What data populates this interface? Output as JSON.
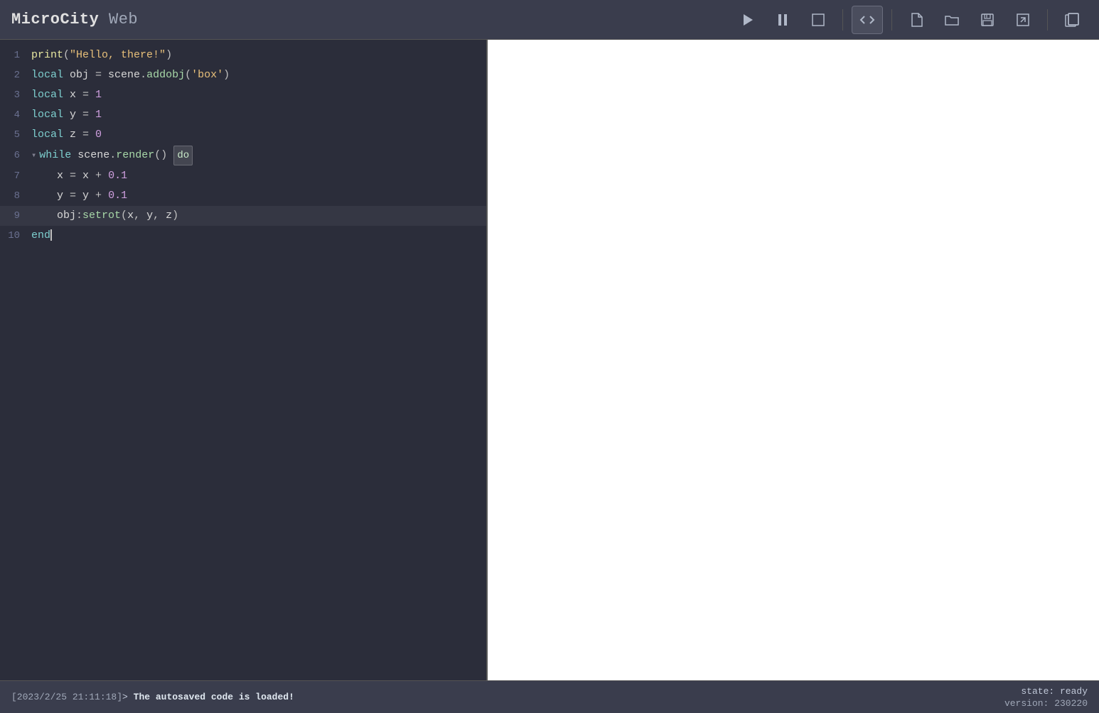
{
  "app": {
    "title_micro": "Micro",
    "title_city": "City",
    "title_web": " Web"
  },
  "toolbar": {
    "run_label": "▶",
    "pause_label": "⏸",
    "stop_label": "☐",
    "code_view_label": "<>",
    "new_file_label": "🗋",
    "open_file_label": "🗁",
    "save_file_label": "💾",
    "export_label": "⬡",
    "multi_file_label": "❑"
  },
  "editor": {
    "lines": [
      {
        "num": 1,
        "tokens": [
          {
            "type": "fn",
            "text": "print"
          },
          {
            "type": "punc",
            "text": "("
          },
          {
            "type": "str",
            "text": "\"Hello, there!\""
          },
          {
            "type": "punc",
            "text": ")"
          }
        ]
      },
      {
        "num": 2,
        "tokens": [
          {
            "type": "kw",
            "text": "local"
          },
          {
            "type": "var",
            "text": " obj "
          },
          {
            "type": "op",
            "text": "="
          },
          {
            "type": "var",
            "text": " scene"
          },
          {
            "type": "punc",
            "text": "."
          },
          {
            "type": "method",
            "text": "addobj"
          },
          {
            "type": "punc",
            "text": "("
          },
          {
            "type": "str",
            "text": "'box'"
          },
          {
            "type": "punc",
            "text": ")"
          }
        ]
      },
      {
        "num": 3,
        "tokens": [
          {
            "type": "kw",
            "text": "local"
          },
          {
            "type": "var",
            "text": " x "
          },
          {
            "type": "op",
            "text": "="
          },
          {
            "type": "num",
            "text": " 1"
          }
        ]
      },
      {
        "num": 4,
        "tokens": [
          {
            "type": "kw",
            "text": "local"
          },
          {
            "type": "var",
            "text": " y "
          },
          {
            "type": "op",
            "text": "="
          },
          {
            "type": "num",
            "text": " 1"
          }
        ]
      },
      {
        "num": 5,
        "tokens": [
          {
            "type": "kw",
            "text": "local"
          },
          {
            "type": "var",
            "text": " z "
          },
          {
            "type": "op",
            "text": "="
          },
          {
            "type": "num",
            "text": " 0"
          }
        ]
      },
      {
        "num": 6,
        "tokens": [
          {
            "type": "kw",
            "text": "while"
          },
          {
            "type": "var",
            "text": " scene"
          },
          {
            "type": "punc",
            "text": "."
          },
          {
            "type": "method",
            "text": "render"
          },
          {
            "type": "punc",
            "text": "() "
          },
          {
            "type": "kw-badge",
            "text": "do"
          }
        ],
        "fold": true
      },
      {
        "num": 7,
        "tokens": [
          {
            "type": "var",
            "text": "    x "
          },
          {
            "type": "op",
            "text": "="
          },
          {
            "type": "var",
            "text": " x "
          },
          {
            "type": "op",
            "text": "+"
          },
          {
            "type": "num",
            "text": " 0.1"
          }
        ]
      },
      {
        "num": 8,
        "tokens": [
          {
            "type": "var",
            "text": "    y "
          },
          {
            "type": "op",
            "text": "="
          },
          {
            "type": "var",
            "text": " y "
          },
          {
            "type": "op",
            "text": "+"
          },
          {
            "type": "num",
            "text": " 0.1"
          }
        ]
      },
      {
        "num": 9,
        "tokens": [
          {
            "type": "var",
            "text": "    obj"
          },
          {
            "type": "punc",
            "text": ":"
          },
          {
            "type": "method",
            "text": "setrot"
          },
          {
            "type": "punc",
            "text": "("
          },
          {
            "type": "var",
            "text": "x"
          },
          {
            "type": "punc",
            "text": ", "
          },
          {
            "type": "var",
            "text": "y"
          },
          {
            "type": "punc",
            "text": ", "
          },
          {
            "type": "var",
            "text": "z"
          },
          {
            "type": "punc",
            "text": ")"
          }
        ],
        "highlighted": true
      },
      {
        "num": 10,
        "tokens": [
          {
            "type": "kw",
            "text": "end"
          }
        ],
        "cursor": true
      }
    ]
  },
  "statusbar": {
    "timestamp": "[2023/2/25 21:11:18]",
    "prompt": "> ",
    "message": "The autosaved code is loaded!",
    "state_label": "state:",
    "state_value": "ready",
    "version_label": "version:",
    "version_value": "230220"
  }
}
